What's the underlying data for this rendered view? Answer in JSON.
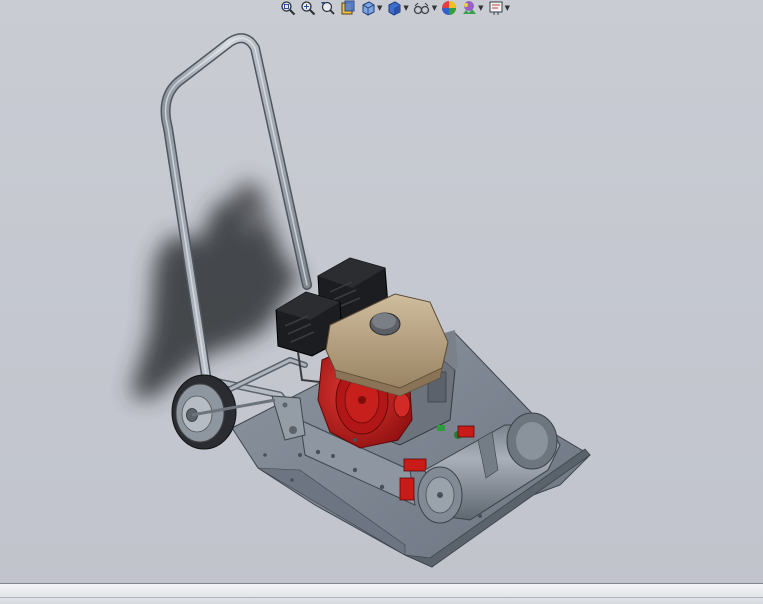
{
  "window": {
    "background_top": "#c9ccd3",
    "background_bottom": "#c1c4cc"
  },
  "heads_up_toolbar": {
    "buttons": [
      {
        "icon": "zoom-to-fit-icon"
      },
      {
        "icon": "zoom-to-area-icon"
      },
      {
        "icon": "previous-view-icon"
      },
      {
        "icon": "section-view-icon"
      },
      {
        "icon": "view-orientation-icon"
      },
      {
        "icon": "display-style-icon"
      },
      {
        "icon": "hide-show-items-icon"
      },
      {
        "icon": "edit-appearance-icon"
      },
      {
        "icon": "apply-scene-icon"
      },
      {
        "icon": "view-settings-icon"
      }
    ]
  },
  "model": {
    "name": "plate compactor",
    "colors": {
      "frame": "#aab1ba",
      "base_plate": "#7d8691",
      "engine_red": "#c01818",
      "tank_tan": "#b49c78",
      "filter_black": "#1c1d20",
      "shadow": "#2e3034"
    }
  }
}
